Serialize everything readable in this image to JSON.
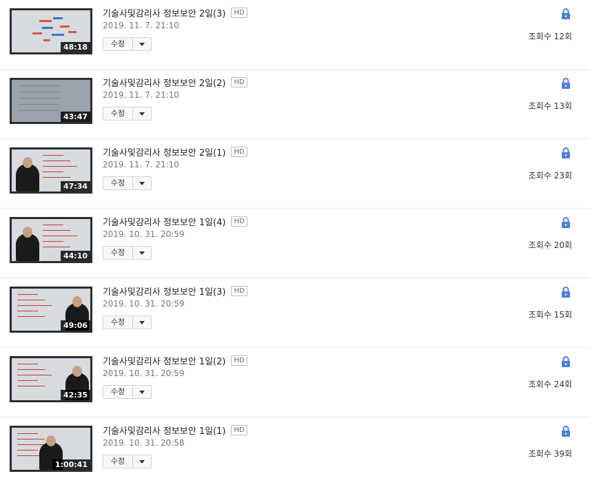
{
  "videos": [
    {
      "title": "기술사및감리사 정보보안 2일(3)",
      "hd": "HD",
      "date": "2019. 11. 7. 21:10",
      "edit_label": "수정",
      "duration": "48:18",
      "views": "조회수 12회",
      "privacy": "lock-icon",
      "style": "diagram"
    },
    {
      "title": "기술사및감리사 정보보안 2일(2)",
      "hd": "HD",
      "date": "2019. 11. 7. 21:10",
      "edit_label": "수정",
      "duration": "43:47",
      "views": "조회수 13회",
      "privacy": "lock-icon",
      "style": "screen"
    },
    {
      "title": "기술사및감리사 정보보안 2일(1)",
      "hd": "HD",
      "date": "2019. 11. 7. 21:10",
      "edit_label": "수정",
      "duration": "47:34",
      "views": "조회수 23회",
      "privacy": "lock-icon",
      "style": "lecture-left"
    },
    {
      "title": "기술사및감리사 정보보안 1일(4)",
      "hd": "HD",
      "date": "2019. 10. 31. 20:59",
      "edit_label": "수정",
      "duration": "44:10",
      "views": "조회수 20회",
      "privacy": "lock-icon",
      "style": "lecture-left"
    },
    {
      "title": "기술사및감리사 정보보안 1일(3)",
      "hd": "HD",
      "date": "2019. 10. 31. 20:59",
      "edit_label": "수정",
      "duration": "49:06",
      "views": "조회수 15회",
      "privacy": "lock-icon",
      "style": "lecture-right"
    },
    {
      "title": "기술사및감리사 정보보안 1일(2)",
      "hd": "HD",
      "date": "2019. 10. 31. 20:59",
      "edit_label": "수정",
      "duration": "42:35",
      "views": "조회수 24회",
      "privacy": "lock-icon",
      "style": "lecture-right"
    },
    {
      "title": "기술사및감리사 정보보안 1일(1)",
      "hd": "HD",
      "date": "2019. 10. 31. 20:58",
      "edit_label": "수정",
      "duration": "1:00:41",
      "views": "조회수 39회",
      "privacy": "lock-icon",
      "style": "lecture-center"
    }
  ],
  "colors": {
    "lock": "#4a7ee0",
    "diagram_red": "#d9533f",
    "diagram_blue": "#3a6fd0"
  }
}
